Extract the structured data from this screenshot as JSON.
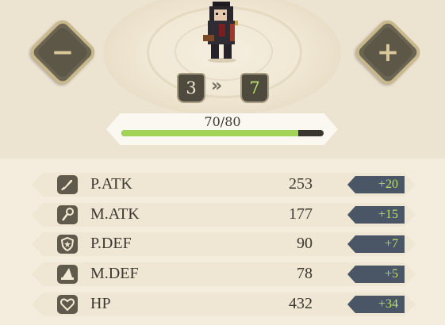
{
  "controls": {
    "decrease_glyph": "−",
    "increase_glyph": "+"
  },
  "level": {
    "from": "3",
    "to": "7",
    "arrow_glyph": "»"
  },
  "exp": {
    "text": "70/80",
    "current": 70,
    "max": 80
  },
  "stats": [
    {
      "icon": "sword-icon",
      "name": "P.ATK",
      "value": "253",
      "bonus": "+20"
    },
    {
      "icon": "staff-icon",
      "name": "M.ATK",
      "value": "177",
      "bonus": "+15"
    },
    {
      "icon": "shield-icon",
      "name": "P.DEF",
      "value": "90",
      "bonus": "+7"
    },
    {
      "icon": "wizard-hat-icon",
      "name": "M.DEF",
      "value": "78",
      "bonus": "+5"
    },
    {
      "icon": "heart-icon",
      "name": "HP",
      "value": "432",
      "bonus": "+34"
    }
  ],
  "colors": {
    "exp_fill": "#a3d45a",
    "bonus_text": "#b6e06a",
    "target_level": "#b6e06a"
  }
}
